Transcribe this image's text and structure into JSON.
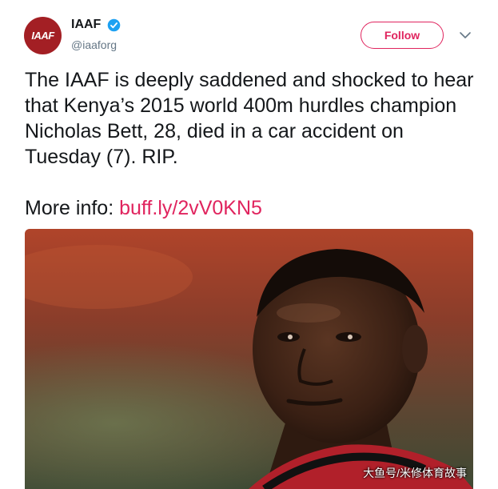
{
  "account": {
    "name": "IAAF",
    "handle": "@iaaforg",
    "avatar_text": "IAAF",
    "verified": true
  },
  "follow_button": {
    "label": "Follow"
  },
  "icons": {
    "verified": "verified-badge-icon",
    "menu": "chevron-down-icon"
  },
  "tweet": {
    "text": "The IAAF is deeply saddened and shocked to hear that Kenya’s 2015 world 400m hurdles champion Nicholas Bett, 28, died in a car accident on Tuesday (7). RIP.",
    "more_info_label": "More info:",
    "link_text": "buff.ly/2vV0KN5"
  },
  "photo": {
    "watermark": "大鱼号/米修体育故事"
  },
  "colors": {
    "brand_red": "#e0245e",
    "avatar_red": "#a31f24",
    "verified_blue": "#1da1f2",
    "text": "#14171a",
    "secondary": "#657786"
  }
}
